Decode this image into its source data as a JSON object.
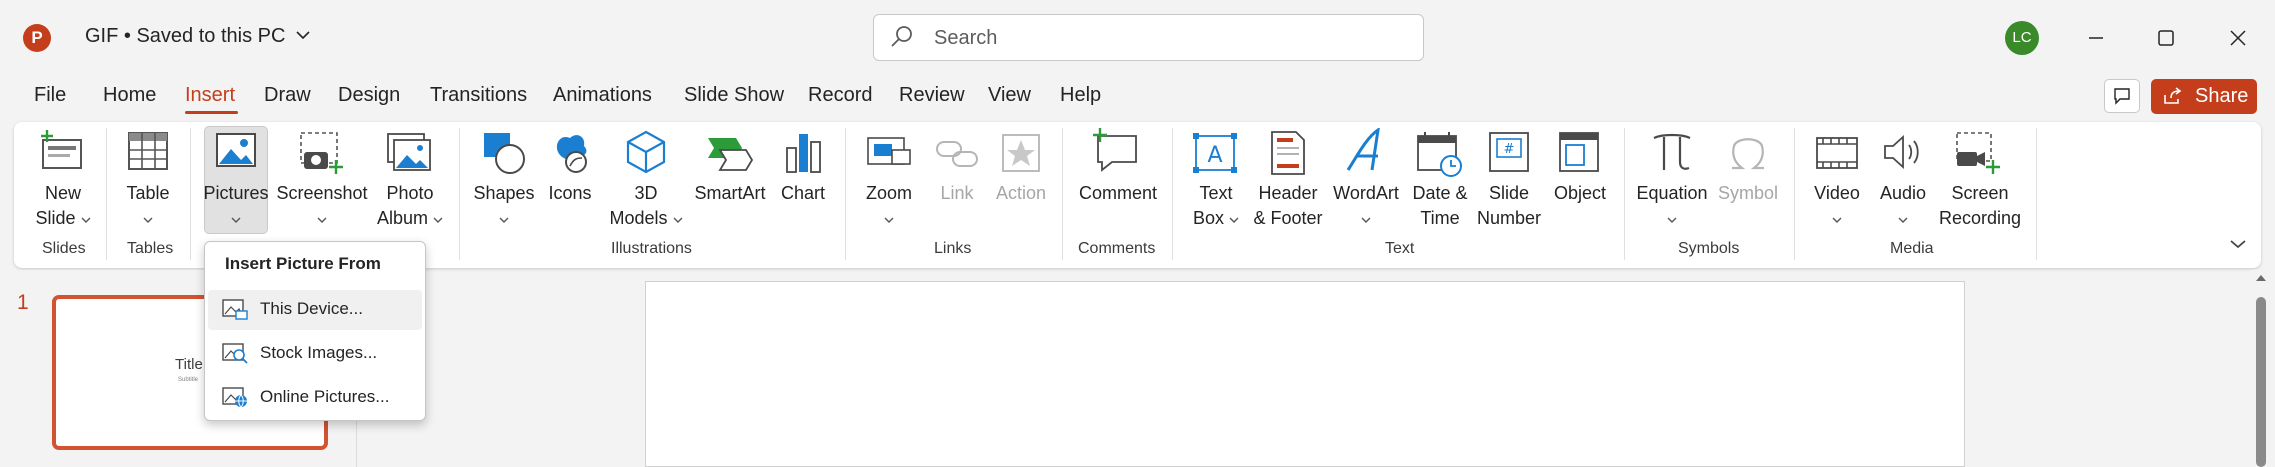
{
  "app": {
    "logo_letter": "P",
    "doc_title": "GIF • Saved to this PC",
    "accent": "#c43e1c"
  },
  "search": {
    "placeholder": "Search"
  },
  "user": {
    "initials": "LC"
  },
  "menu": {
    "tabs": [
      "File",
      "Home",
      "Insert",
      "Draw",
      "Design",
      "Transitions",
      "Animations",
      "Slide Show",
      "Record",
      "Review",
      "View",
      "Help"
    ],
    "active_tab": "Insert",
    "share_label": "Share"
  },
  "ribbon": {
    "groups": {
      "slides": "Slides",
      "tables": "Tables",
      "illustrations": "Illustrations",
      "links": "Links",
      "comments": "Comments",
      "text": "Text",
      "symbols": "Symbols",
      "media": "Media"
    },
    "buttons": {
      "new_slide": [
        "New",
        "Slide"
      ],
      "table": "Table",
      "pictures": "Pictures",
      "screenshot": "Screenshot",
      "photo_album": [
        "Photo",
        "Album"
      ],
      "shapes": "Shapes",
      "icons": "Icons",
      "models_3d": [
        "3D",
        "Models"
      ],
      "smartart": "SmartArt",
      "chart": "Chart",
      "zoom": "Zoom",
      "link": "Link",
      "action": "Action",
      "comment": "Comment",
      "text_box": [
        "Text",
        "Box"
      ],
      "header_footer": [
        "Header",
        "& Footer"
      ],
      "wordart": "WordArt",
      "date_time": [
        "Date &",
        "Time"
      ],
      "slide_number": [
        "Slide",
        "Number"
      ],
      "object": "Object",
      "equation": "Equation",
      "symbol": "Symbol",
      "video": "Video",
      "audio": "Audio",
      "screen_recording": [
        "Screen",
        "Recording"
      ]
    }
  },
  "dropdown": {
    "header": "Insert Picture From",
    "items": [
      "This Device...",
      "Stock Images...",
      "Online Pictures..."
    ],
    "highlighted_index": 0
  },
  "slides_panel": {
    "slide_number": "1",
    "thumb_title": "Title",
    "thumb_subtitle": "Subtitle"
  }
}
